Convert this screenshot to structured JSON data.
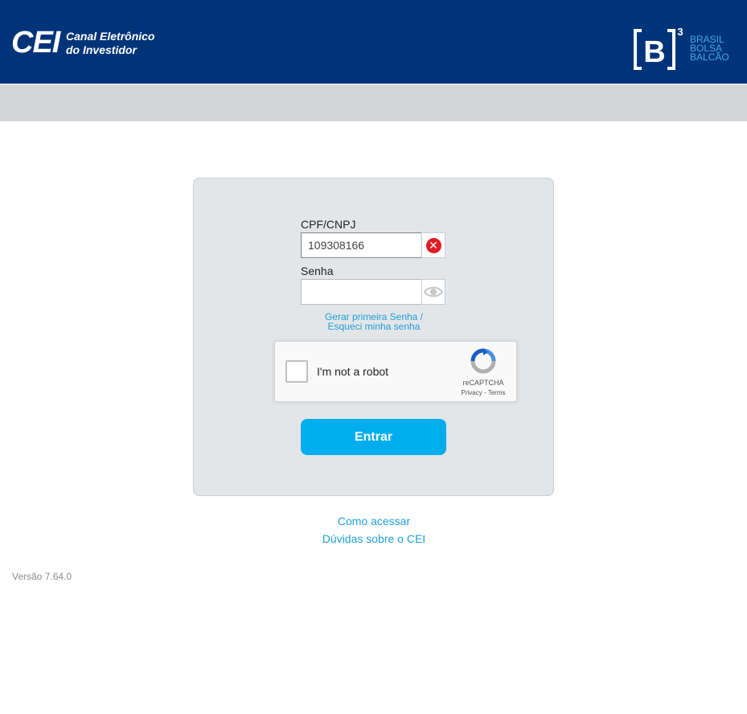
{
  "header": {
    "logo_text": "CEI",
    "subtitle_line1": "Canal Eletrônico",
    "subtitle_line2": "do Investidor",
    "b3_logo": "[B]³",
    "b3_line1": "BRASIL",
    "b3_line2": "BOLSA",
    "b3_line3": "BALCÃO"
  },
  "form": {
    "cpf_label": "CPF/CNPJ",
    "cpf_value": "109308166",
    "clear_icon": "clear-x-icon",
    "password_label": "Senha",
    "password_value": "",
    "show_password_icon": "eye-icon",
    "forgot_link_line1": "Gerar primeira Senha /",
    "forgot_link_line2": "Esqueci minha senha",
    "recaptcha_label": "I'm not a robot",
    "recaptcha_brand": "reCAPTCHA",
    "recaptcha_privacy": "Privacy",
    "recaptcha_separator": "-",
    "recaptcha_terms": "Terms",
    "submit_label": "Entrar"
  },
  "links": {
    "how_to_access": "Como acessar",
    "faq": "Dúvidas sobre o CEI"
  },
  "footer": {
    "version": "Versão 7.64.0"
  },
  "colors": {
    "header_bg": "#003478",
    "accent": "#00aeef",
    "link": "#1e9fd6",
    "error": "#e01b24"
  }
}
